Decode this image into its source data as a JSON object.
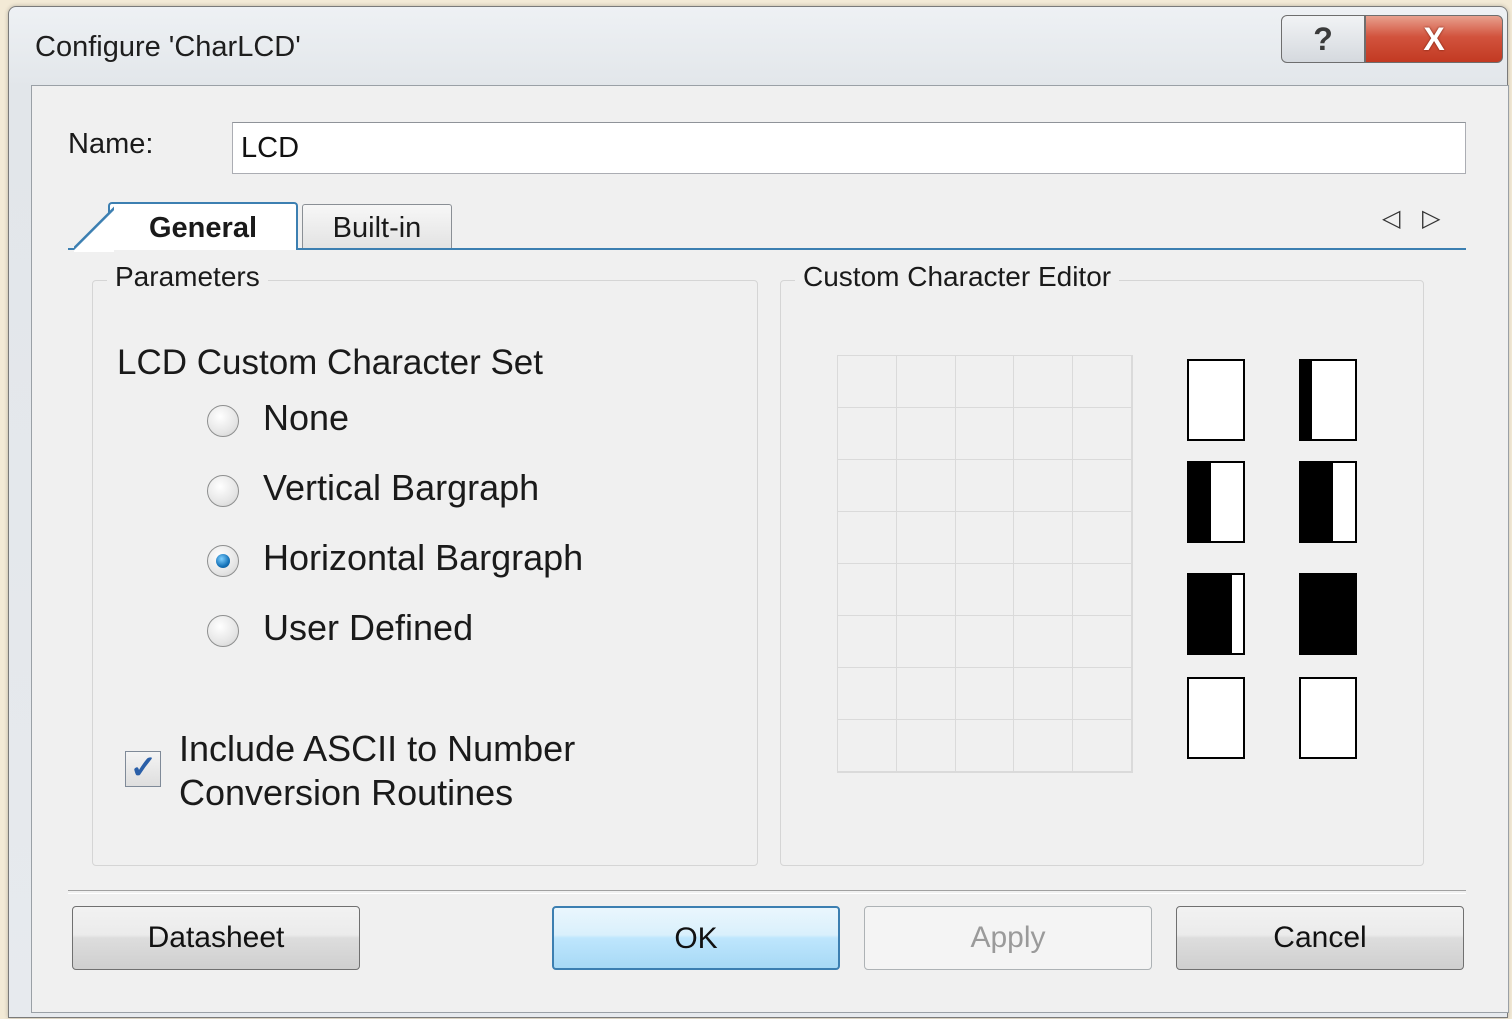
{
  "window": {
    "title": "Configure 'CharLCD'",
    "help_glyph": "?",
    "close_glyph": "X"
  },
  "name_field": {
    "label": "Name:",
    "value": "LCD"
  },
  "tabs": [
    {
      "label": "General",
      "selected": true
    },
    {
      "label": "Built-in",
      "selected": false
    }
  ],
  "tab_scroll": {
    "left": "◁",
    "right": "▷"
  },
  "parameters": {
    "title": "Parameters",
    "heading": "LCD Custom Character Set",
    "options": [
      {
        "label": "None",
        "selected": false
      },
      {
        "label": "Vertical Bargraph",
        "selected": false
      },
      {
        "label": "Horizontal Bargraph",
        "selected": true
      },
      {
        "label": "User Defined",
        "selected": false
      }
    ],
    "checkbox": {
      "line1": "Include ASCII to Number",
      "line2": "Conversion Routines",
      "checked": true,
      "check_glyph": "✓"
    }
  },
  "editor": {
    "title": "Custom Character Editor",
    "grid": {
      "columns": 5,
      "rows": 8
    },
    "glyph_fill_fractions": [
      0,
      0.2,
      0.4,
      0.6,
      0.8,
      1.0,
      0,
      0
    ]
  },
  "buttons": {
    "datasheet": "Datasheet",
    "ok": "OK",
    "apply": "Apply",
    "cancel": "Cancel"
  },
  "colors": {
    "accent": "#3c7fb1",
    "close": "#c23a22",
    "window_bg": "#f0f0f0"
  }
}
